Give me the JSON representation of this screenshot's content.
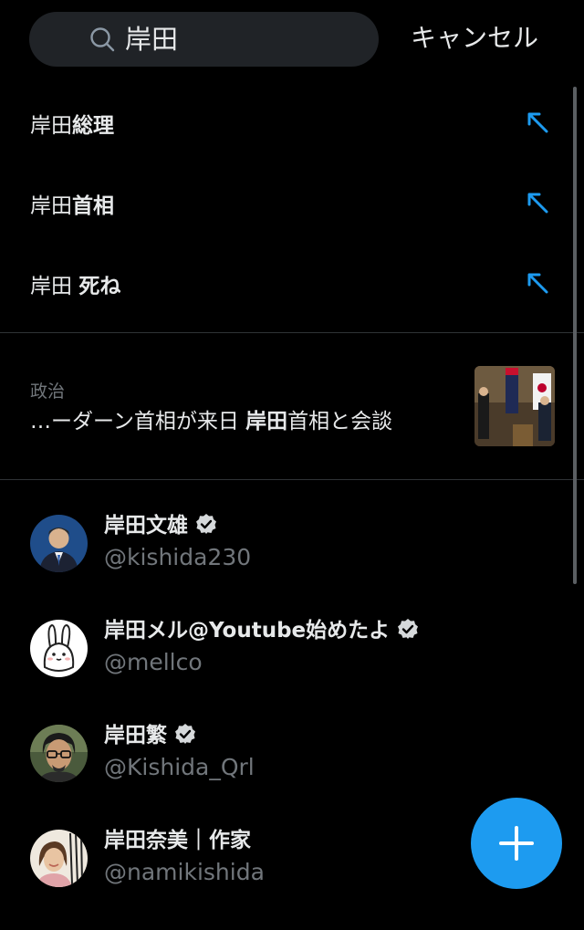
{
  "search": {
    "query": "岸田",
    "cancel_label": "キャンセル"
  },
  "suggestions": [
    {
      "prefix": "岸田",
      "suffix": "総理"
    },
    {
      "prefix": "岸田",
      "suffix": "首相"
    },
    {
      "prefix": "岸田 ",
      "suffix": "死ね"
    }
  ],
  "trend": {
    "category": "政治",
    "pre": "…ーダーン首相が来日 ",
    "bold": "岸田",
    "post": "首相と会談"
  },
  "users": [
    {
      "name": "岸田文雄",
      "handle": "@kishida230"
    },
    {
      "name": "岸田メル@Youtube始めたよ",
      "handle": "@mellco"
    },
    {
      "name": "岸田繁",
      "handle": "@Kishida_Qrl"
    },
    {
      "name": "岸田奈美｜作家",
      "handle": "@namikishida"
    }
  ],
  "colors": {
    "accent": "#1d9bf0",
    "background": "#000000",
    "secondary_text": "#71767b"
  }
}
